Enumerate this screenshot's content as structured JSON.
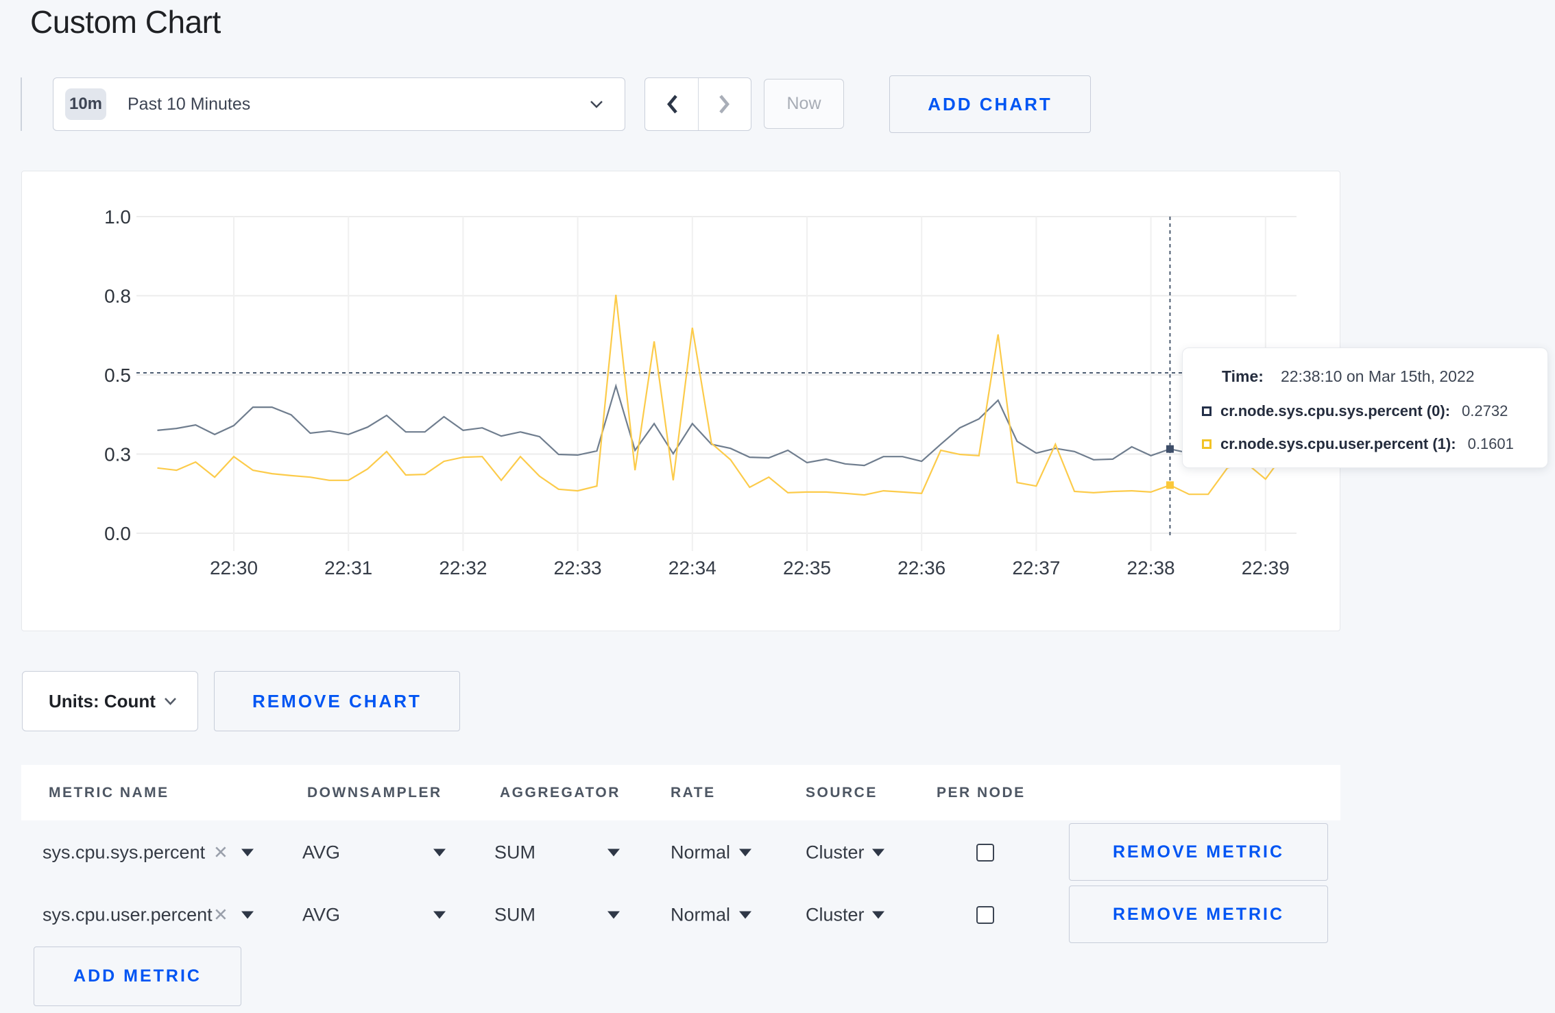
{
  "page": {
    "title": "Custom Chart"
  },
  "toolbar": {
    "range_badge": "10m",
    "range_label": "Past 10 Minutes",
    "now_label": "Now",
    "add_chart_label": "ADD CHART"
  },
  "chart_controls": {
    "units_label": "Units: Count",
    "remove_chart_label": "REMOVE CHART"
  },
  "tooltip": {
    "time_label": "Time:",
    "time_value": "22:38:10 on Mar 15th, 2022",
    "series": [
      {
        "name": "cr.node.sys.cpu.sys.percent (0):",
        "value": "0.2732",
        "swatch_color": "#243049"
      },
      {
        "name": "cr.node.sys.cpu.user.percent (1):",
        "value": "0.1601",
        "swatch_color": "#f2c326"
      }
    ]
  },
  "chart_data": {
    "type": "line",
    "title": "",
    "xlabel": "",
    "ylabel": "",
    "x_tick_labels": [
      "22:30",
      "22:31",
      "22:32",
      "22:33",
      "22:34",
      "22:35",
      "22:36",
      "22:37",
      "22:38",
      "22:39"
    ],
    "y_tick_labels": [
      "1.0",
      "0.8",
      "0.5",
      "0.3",
      "0.0"
    ],
    "y_tick_values": [
      1,
      0.75,
      0.5,
      0.25,
      0
    ],
    "ylim": [
      0,
      1
    ],
    "x_start_sec": -40,
    "x_step_sec": 10,
    "series": [
      {
        "name": "cr.node.sys.cpu.sys.percent",
        "color": "#6f7d8e",
        "values": [
          0.325,
          0.331,
          0.342,
          0.312,
          0.34,
          0.398,
          0.398,
          0.374,
          0.316,
          0.323,
          0.312,
          0.335,
          0.372,
          0.32,
          0.32,
          0.368,
          0.325,
          0.333,
          0.307,
          0.32,
          0.305,
          0.249,
          0.247,
          0.26,
          0.465,
          0.262,
          0.346,
          0.251,
          0.346,
          0.281,
          0.268,
          0.24,
          0.238,
          0.262,
          0.223,
          0.234,
          0.219,
          0.214,
          0.242,
          0.242,
          0.227,
          0.281,
          0.333,
          0.361,
          0.42,
          0.29,
          0.253,
          0.268,
          0.258,
          0.232,
          0.234,
          0.273,
          0.245,
          0.266,
          0.253,
          0.264,
          0.253,
          0.271,
          0.258,
          0.264
        ]
      },
      {
        "name": "cr.node.sys.cpu.user.percent",
        "color": "#fccb4a",
        "values": [
          0.206,
          0.199,
          0.225,
          0.177,
          0.242,
          0.199,
          0.188,
          0.182,
          0.177,
          0.167,
          0.167,
          0.203,
          0.258,
          0.184,
          0.186,
          0.227,
          0.24,
          0.242,
          0.167,
          0.242,
          0.18,
          0.139,
          0.134,
          0.149,
          0.753,
          0.199,
          0.606,
          0.167,
          0.649,
          0.284,
          0.232,
          0.145,
          0.177,
          0.128,
          0.13,
          0.13,
          0.126,
          0.121,
          0.134,
          0.13,
          0.126,
          0.262,
          0.249,
          0.245,
          0.628,
          0.16,
          0.149,
          0.281,
          0.132,
          0.128,
          0.132,
          0.134,
          0.13,
          0.152,
          0.123,
          0.123,
          0.206,
          0.221,
          0.171,
          0.253
        ]
      }
    ],
    "crosshair": {
      "time_sec": 490,
      "hline_value": 0.5065,
      "marker_values": [
        0.266,
        0.152
      ],
      "color": "#4b5b70"
    },
    "grid": true,
    "legend_position": "tooltip"
  },
  "metrics_table": {
    "headers": [
      "METRIC NAME",
      "DOWNSAMPLER",
      "AGGREGATOR",
      "RATE",
      "SOURCE",
      "PER NODE"
    ],
    "rows": [
      {
        "metric": "sys.cpu.sys.percent",
        "downsampler": "AVG",
        "aggregator": "SUM",
        "rate": "Normal",
        "source": "Cluster",
        "per_node_checked": false,
        "remove_label": "REMOVE METRIC"
      },
      {
        "metric": "sys.cpu.user.percent",
        "downsampler": "AVG",
        "aggregator": "SUM",
        "rate": "Normal",
        "source": "Cluster",
        "per_node_checked": false,
        "remove_label": "REMOVE METRIC"
      }
    ],
    "add_metric_label": "ADD METRIC"
  }
}
